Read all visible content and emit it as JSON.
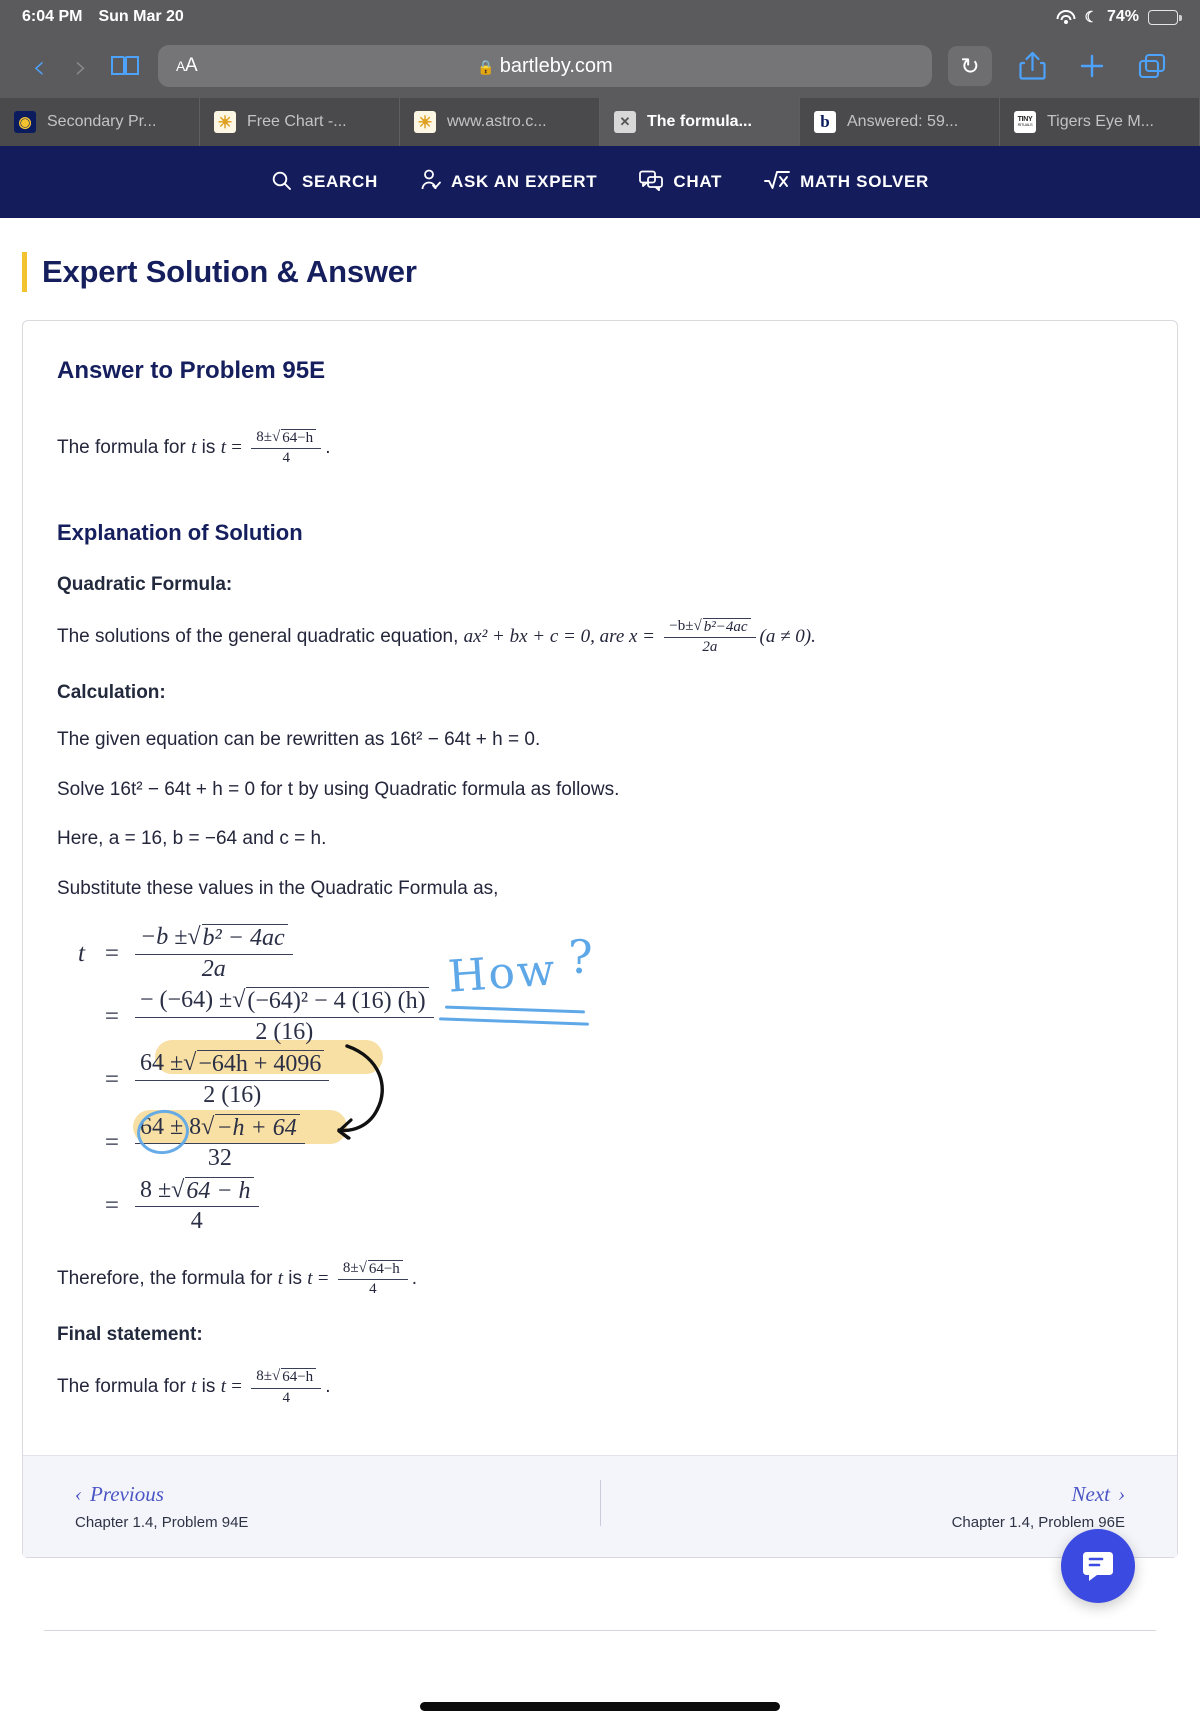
{
  "status_bar": {
    "time": "6:04 PM",
    "date": "Sun Mar 20",
    "battery_percent": "74%",
    "wifi_icon": "wifi-icon",
    "moon_icon": "☾",
    "battery_icon": "battery-icon"
  },
  "browser": {
    "back_icon": "‹",
    "forward_icon": "›",
    "sidebar_icon": "book-icon",
    "text_size_label": "AA",
    "url": "bartleby.com",
    "lock_icon": "🔒",
    "reload_icon": "↻",
    "share_icon": "share-icon",
    "new_tab_icon": "+",
    "tabs_overview_icon": "tabs-icon"
  },
  "tabs": [
    {
      "title": "Secondary Pr...",
      "favicon": "bartleby-logo",
      "active": false
    },
    {
      "title": "Free Chart -...",
      "favicon": "sun-chart",
      "active": false
    },
    {
      "title": "www.astro.c...",
      "favicon": "sun-chart",
      "active": false
    },
    {
      "title": "The formula...",
      "favicon": "x-close",
      "active": true
    },
    {
      "title": "Answered: 59...",
      "favicon": "bartleby-b",
      "active": false
    },
    {
      "title": "Tigers Eye M...",
      "favicon": "tiny-rituals",
      "active": false
    }
  ],
  "site_nav": {
    "background": "#141c5c",
    "items": [
      {
        "label": "SEARCH",
        "icon": "search-icon",
        "glyph": "⌕"
      },
      {
        "label": "ASK AN EXPERT",
        "icon": "person-check-icon",
        "glyph": "person"
      },
      {
        "label": "CHAT",
        "icon": "chat-bubble-icon",
        "glyph": "chat"
      },
      {
        "label": "MATH SOLVER",
        "icon": "math-solver-icon",
        "glyph": "√x"
      }
    ]
  },
  "page": {
    "title": "Expert Solution & Answer",
    "accent_color": "#f2c230",
    "heading_color": "#161f5e"
  },
  "answer": {
    "heading": "Answer to Problem 95E",
    "formula_prefix": "The formula for",
    "var_t": "t",
    "is_word": "is",
    "eq": "=",
    "result_num": "8±",
    "result_radicand": "64−h",
    "result_den": "4",
    "period": "."
  },
  "explanation": {
    "heading": "Explanation of Solution",
    "quadratic_label": "Quadratic Formula:",
    "quadratic_text_a": "The solutions of the general quadratic equation,",
    "quadratic_eqn": "ax² + bx + c = 0, are x =",
    "qf_num": "−b±",
    "qf_radicand": "b²−4ac",
    "qf_den": "2a",
    "qf_condition": "(a ≠ 0).",
    "calculation_label": "Calculation:",
    "line_rewrite": "The given equation can be rewritten as 16t² − 64t + h = 0.",
    "line_solve": "Solve 16t² − 64t + h = 0 for t by using Quadratic formula as follows.",
    "line_here": "Here, a = 16, b = −64 and c = h.",
    "line_substitute": "Substitute these values in the Quadratic Formula as,",
    "therefore_text": "Therefore, the formula for",
    "final_label": "Final statement:"
  },
  "derivation": {
    "rows": [
      {
        "lhs": "t",
        "op": "=",
        "num": "−b ± √(b² − 4ac)",
        "num_prefix": "−b ±",
        "num_radicand": "b² − 4ac",
        "den": "2a"
      },
      {
        "lhs": "",
        "op": "=",
        "num_prefix": "− (−64) ±",
        "num_radicand": "(−64)² − 4 (16) (h)",
        "den": "2 (16)"
      },
      {
        "lhs": "",
        "op": "=",
        "num_prefix": "64 ±",
        "num_radicand": "−64h + 4096",
        "den": "2 (16)",
        "highlighted": true
      },
      {
        "lhs": "",
        "op": "=",
        "num_prefix": "64 ± 8",
        "num_radicand": "−h + 64",
        "den": "32",
        "highlighted": true,
        "circled_token": "8"
      },
      {
        "lhs": "",
        "op": "=",
        "num_prefix": "8 ±",
        "num_radicand": "64 − h",
        "den": "4"
      }
    ]
  },
  "annotations": {
    "how_text": "How",
    "how_question": "?",
    "ink_blue": "#5fa8e8",
    "highlighter_yellow": "#f7dd9c",
    "arrow_color": "#1a1a1a"
  },
  "pager": {
    "previous_label": "Previous",
    "previous_sub": "Chapter 1.4, Problem 94E",
    "previous_icon": "‹",
    "next_label": "Next",
    "next_sub": "Chapter 1.4, Problem 96E",
    "next_icon": "›"
  },
  "fab": {
    "icon": "chat-support-icon",
    "color": "#3b4ae0"
  }
}
